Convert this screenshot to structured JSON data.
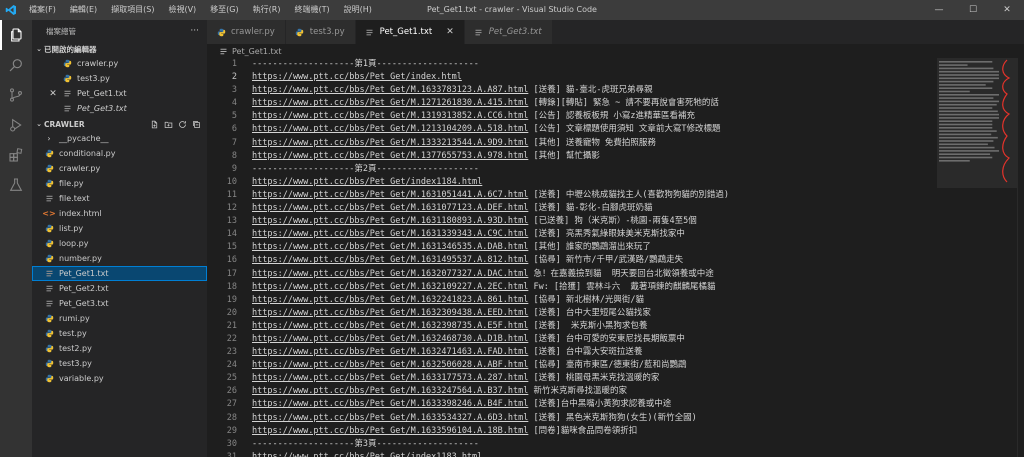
{
  "window": {
    "title": "Pet_Get1.txt - crawler - Visual Studio Code",
    "controls": [
      "—",
      "☐",
      "✕"
    ]
  },
  "menu": [
    "檔案(F)",
    "編輯(E)",
    "擷取項目(S)",
    "檢視(V)",
    "移至(G)",
    "執行(R)",
    "終端機(T)",
    "說明(H)"
  ],
  "sidebar": {
    "title": "檔案總管",
    "more": "···",
    "open_editors": {
      "label": "已開啟的編輯器",
      "items": [
        {
          "name": "crawler.py",
          "icon": "python",
          "italic": false,
          "close": false
        },
        {
          "name": "test3.py",
          "icon": "python",
          "italic": false,
          "close": false
        },
        {
          "name": "Pet_Get1.txt",
          "icon": "text",
          "italic": false,
          "close": true
        },
        {
          "name": "Pet_Get3.txt",
          "icon": "text",
          "italic": true,
          "close": false
        }
      ]
    },
    "folder": {
      "label": "CRAWLER",
      "items": [
        {
          "name": "__pycache__",
          "icon": "folder"
        },
        {
          "name": "conditional.py",
          "icon": "python"
        },
        {
          "name": "crawler.py",
          "icon": "python"
        },
        {
          "name": "file.py",
          "icon": "python"
        },
        {
          "name": "file.text",
          "icon": "text"
        },
        {
          "name": "index.html",
          "icon": "html"
        },
        {
          "name": "list.py",
          "icon": "python"
        },
        {
          "name": "loop.py",
          "icon": "python"
        },
        {
          "name": "number.py",
          "icon": "python"
        },
        {
          "name": "Pet_Get1.txt",
          "icon": "text",
          "selected": true
        },
        {
          "name": "Pet_Get2.txt",
          "icon": "text"
        },
        {
          "name": "Pet_Get3.txt",
          "icon": "text"
        },
        {
          "name": "rumi.py",
          "icon": "python"
        },
        {
          "name": "test.py",
          "icon": "python"
        },
        {
          "name": "test2.py",
          "icon": "python"
        },
        {
          "name": "test3.py",
          "icon": "python"
        },
        {
          "name": "variable.py",
          "icon": "python"
        }
      ]
    }
  },
  "tabs": [
    {
      "label": "crawler.py",
      "icon": "python",
      "active": false,
      "italic": false
    },
    {
      "label": "test3.py",
      "icon": "python",
      "active": false,
      "italic": false
    },
    {
      "label": "Pet_Get1.txt",
      "icon": "text",
      "active": true,
      "italic": false
    },
    {
      "label": "Pet_Get3.txt",
      "icon": "text",
      "active": false,
      "italic": true
    }
  ],
  "breadcrumb": "Pet_Get1.txt",
  "editor": {
    "current_line": 2,
    "lines": [
      {
        "url": "",
        "text": "--------------------第1頁--------------------"
      },
      {
        "url": "https://www.ptt.cc/bbs/Pet_Get/index.html",
        "text": ""
      },
      {
        "url": "https://www.ptt.cc/bbs/Pet_Get/M.1633783123.A.A87.html",
        "text": " [送養] 貓-臺北-虎斑兄弟尋親"
      },
      {
        "url": "https://www.ptt.cc/bbs/Pet_Get/M.1271261830.A.415.html",
        "text": " [轉錄][轉貼] 緊急 ~ 請不要再說會害死牠的話"
      },
      {
        "url": "https://www.ptt.cc/bbs/Pet_Get/M.1319313852.A.CC6.html",
        "text": " [公告] 認養板板規 小寫z進精華區看補充"
      },
      {
        "url": "https://www.ptt.cc/bbs/Pet_Get/M.1213104209.A.518.html",
        "text": " [公告] 文章標題使用須知 文章前大寫T修改標題"
      },
      {
        "url": "https://www.ptt.cc/bbs/Pet_Get/M.1333213544.A.9D9.html",
        "text": " [其他] 送養寵物 免費拍照服務"
      },
      {
        "url": "https://www.ptt.cc/bbs/Pet_Get/M.1377655753.A.978.html",
        "text": " [其他] 幫忙攝影"
      },
      {
        "url": "",
        "text": "--------------------第2頁--------------------"
      },
      {
        "url": "https://www.ptt.cc/bbs/Pet_Get/index1184.html",
        "text": ""
      },
      {
        "url": "https://www.ptt.cc/bbs/Pet_Get/M.1631051441.A.6C7.html",
        "text": " [送養] 中壢公桃成貓找主人(喜歡狗狗貓的別錯過)"
      },
      {
        "url": "https://www.ptt.cc/bbs/Pet_Get/M.1631077123.A.DEF.html",
        "text": " [送養] 貓-彰化-白腳虎斑奶貓"
      },
      {
        "url": "https://www.ptt.cc/bbs/Pet_Get/M.1631180893.A.93D.html",
        "text": " [已送養] 狗（米克斯）-桃園-兩隻4至5個"
      },
      {
        "url": "https://www.ptt.cc/bbs/Pet_Get/M.1631339343.A.C9C.html",
        "text": " [送養] 亮黑秀氣綠眼妹美米克斯找家中"
      },
      {
        "url": "https://www.ptt.cc/bbs/Pet_Get/M.1631346535.A.DAB.html",
        "text": " [其他] 誰家的鸚鵡溜出來玩了"
      },
      {
        "url": "https://www.ptt.cc/bbs/Pet_Get/M.1631495537.A.812.html",
        "text": " [協尋] 新竹市/千甲/武漢路/鸚鵡走失"
      },
      {
        "url": "https://www.ptt.cc/bbs/Pet_Get/M.1632077327.A.DAC.html",
        "text": " 急！在嘉義撿到貓  明天要回台北徵領養或中途"
      },
      {
        "url": "https://www.ptt.cc/bbs/Pet_Get/M.1632109227.A.2EC.html",
        "text": " Fw: [拾獲] 雲林斗六  戴著項鍊的麒麟尾橘貓"
      },
      {
        "url": "https://www.ptt.cc/bbs/Pet_Get/M.1632241823.A.861.html",
        "text": " [協尋] 新北樹林/光興街/貓"
      },
      {
        "url": "https://www.ptt.cc/bbs/Pet_Get/M.1632309438.A.EED.html",
        "text": " [送養] 台中大里短尾公貓找家"
      },
      {
        "url": "https://www.ptt.cc/bbs/Pet_Get/M.1632398735.A.E5F.html",
        "text": " [送養]  米克斯小黑狗求包養"
      },
      {
        "url": "https://www.ptt.cc/bbs/Pet_Get/M.1632468730.A.D1B.html",
        "text": " [送養] 台中可愛的安東尼找長期飯票中"
      },
      {
        "url": "https://www.ptt.cc/bbs/Pet_Get/M.1632471463.A.FAD.html",
        "text": " [送養] 台中霧大安斑拉送養"
      },
      {
        "url": "https://www.ptt.cc/bbs/Pet_Get/M.1632506028.A.ABF.html",
        "text": " [協尋] 臺南市東區/德東街/藍和尚鸚鵡"
      },
      {
        "url": "https://www.ptt.cc/bbs/Pet_Get/M.1633177573.A.287.html",
        "text": " [送養] 桃園母黑米克找溫暖的家"
      },
      {
        "url": "https://www.ptt.cc/bbs/Pet_Get/M.1633247564.A.B37.html",
        "text": " 新竹米克斯尋找溫暖的家"
      },
      {
        "url": "https://www.ptt.cc/bbs/Pet_Get/M.1633398246.A.B4F.html",
        "text": " [送養]台中黑嘴小黃狗求認養或中途"
      },
      {
        "url": "https://www.ptt.cc/bbs/Pet_Get/M.1633534327.A.6D3.html",
        "text": " [送養] 黑色米克斯狗狗(女生)(新竹全國)"
      },
      {
        "url": "https://www.ptt.cc/bbs/Pet_Get/M.1633596104.A.18B.html",
        "text": " [問卷]貓咪食品問卷領折扣"
      },
      {
        "url": "",
        "text": "--------------------第3頁--------------------"
      },
      {
        "url": "https://www.ptt.cc/bbs/Pet_Get/index1183.html",
        "text": ""
      }
    ]
  },
  "colors": {
    "titlebar": "#3c3c3c",
    "activitybar": "#333333",
    "sidebar": "#252526",
    "editor": "#1e1e1e",
    "selection": "#094771",
    "python_icon": "#3572a5",
    "html_icon": "#e37933",
    "minimap_annotation": "#e5332a"
  }
}
